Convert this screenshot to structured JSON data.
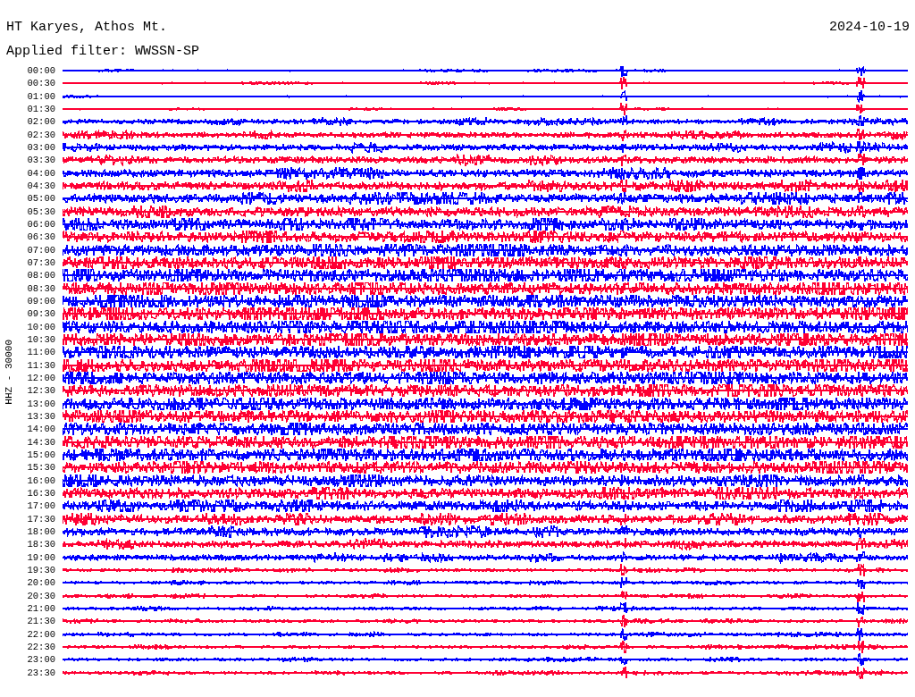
{
  "header": {
    "station": "HT Karyes, Athos Mt.",
    "date": "2024-10-19",
    "filter": "Applied filter: WWSSN-SP"
  },
  "axis_label": "HHZ - 30000",
  "rows": [
    {
      "time": "00:00",
      "color": "#0000ff"
    },
    {
      "time": "00:30",
      "color": "#ff0033"
    },
    {
      "time": "01:00",
      "color": "#0000ff"
    },
    {
      "time": "01:30",
      "color": "#ff0033"
    },
    {
      "time": "02:00",
      "color": "#0000ff"
    },
    {
      "time": "02:30",
      "color": "#ff0033"
    },
    {
      "time": "03:00",
      "color": "#0000ff"
    },
    {
      "time": "03:30",
      "color": "#ff0033"
    },
    {
      "time": "04:00",
      "color": "#0000ff"
    },
    {
      "time": "04:30",
      "color": "#ff0033"
    },
    {
      "time": "05:00",
      "color": "#0000ff"
    },
    {
      "time": "05:30",
      "color": "#ff0033"
    },
    {
      "time": "06:00",
      "color": "#0000ff"
    },
    {
      "time": "06:30",
      "color": "#ff0033"
    },
    {
      "time": "07:00",
      "color": "#0000ff"
    },
    {
      "time": "07:30",
      "color": "#ff0033"
    },
    {
      "time": "08:00",
      "color": "#0000ff"
    },
    {
      "time": "08:30",
      "color": "#ff0033"
    },
    {
      "time": "09:00",
      "color": "#0000ff"
    },
    {
      "time": "09:30",
      "color": "#ff0033"
    },
    {
      "time": "10:00",
      "color": "#0000ff"
    },
    {
      "time": "10:30",
      "color": "#ff0033"
    },
    {
      "time": "11:00",
      "color": "#0000ff"
    },
    {
      "time": "11:30",
      "color": "#ff0033"
    },
    {
      "time": "12:00",
      "color": "#0000ff"
    },
    {
      "time": "12:30",
      "color": "#ff0033"
    },
    {
      "time": "13:00",
      "color": "#0000ff"
    },
    {
      "time": "13:30",
      "color": "#ff0033"
    },
    {
      "time": "14:00",
      "color": "#0000ff"
    },
    {
      "time": "14:30",
      "color": "#ff0033"
    },
    {
      "time": "15:00",
      "color": "#0000ff"
    },
    {
      "time": "15:30",
      "color": "#ff0033"
    },
    {
      "time": "16:00",
      "color": "#0000ff"
    },
    {
      "time": "16:30",
      "color": "#ff0033"
    },
    {
      "time": "17:00",
      "color": "#0000ff"
    },
    {
      "time": "17:30",
      "color": "#ff0033"
    },
    {
      "time": "18:00",
      "color": "#0000ff"
    },
    {
      "time": "18:30",
      "color": "#ff0033"
    },
    {
      "time": "19:00",
      "color": "#0000ff"
    },
    {
      "time": "19:30",
      "color": "#ff0033"
    },
    {
      "time": "20:00",
      "color": "#0000ff"
    },
    {
      "time": "20:30",
      "color": "#ff0033"
    },
    {
      "time": "21:00",
      "color": "#0000ff"
    },
    {
      "time": "21:30",
      "color": "#ff0033"
    },
    {
      "time": "22:00",
      "color": "#0000ff"
    },
    {
      "time": "22:30",
      "color": "#ff0033"
    },
    {
      "time": "23:00",
      "color": "#0000ff"
    },
    {
      "time": "23:30",
      "color": "#ff0033"
    }
  ]
}
